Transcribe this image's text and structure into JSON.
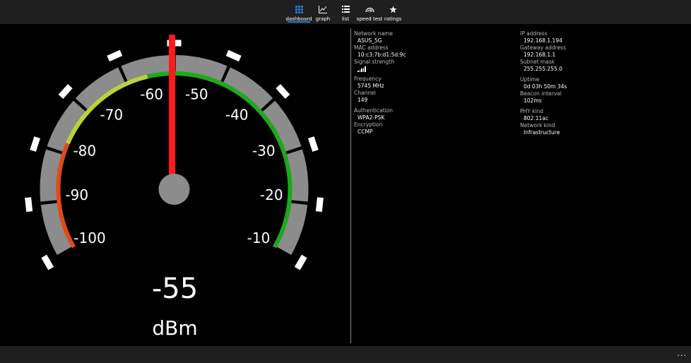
{
  "nav": {
    "items": [
      {
        "label": "dashboard",
        "icon": "grid-icon",
        "active": true
      },
      {
        "label": "graph",
        "icon": "chart-line-icon",
        "active": false
      },
      {
        "label": "list",
        "icon": "list-icon",
        "active": false
      },
      {
        "label": "speed test",
        "icon": "speedometer-icon",
        "active": false
      },
      {
        "label": "ratings",
        "icon": "star-icon",
        "active": false
      }
    ],
    "accent": "#1e7bd4"
  },
  "gauge": {
    "value": "-55",
    "numeric_value": -55,
    "unit": "dBm",
    "scale_min": -100,
    "scale_max": -10,
    "tick_labels": [
      "-100",
      "-90",
      "-80",
      "-70",
      "-60",
      "-50",
      "-40",
      "-30",
      "-20",
      "-10"
    ],
    "colors": {
      "bad": "#e04a1a",
      "fair": "#b9d33a",
      "good": "#1ea81e",
      "needle": "#ff1a1a",
      "ring": "#8c8c8c"
    }
  },
  "info_left": {
    "network_name_label": "Network name",
    "network_name": "ASUS_5G",
    "mac_label": "MAC address",
    "mac": "10:c3:7b:d1:5d:9c",
    "signal_label": "Signal strength",
    "signal_icon": "signal-bars-icon",
    "frequency_label": "Frequency",
    "frequency": "5745 MHz",
    "channel_label": "Channel",
    "channel": "149",
    "auth_label": "Authentication",
    "auth": "WPA2-PSK",
    "encryption_label": "Encryption",
    "encryption": "CCMP"
  },
  "info_right": {
    "ip_label": "IP address",
    "ip": "192.168.1.194",
    "gateway_label": "Gateway address",
    "gateway": "192.168.1.1",
    "subnet_label": "Subnet mask",
    "subnet": "255.255.255.0",
    "uptime_label": "Uptime",
    "uptime": "0d 03h 50m 34s",
    "beacon_label": "Beacon interval",
    "beacon": "102ms",
    "phy_label": "PHY kind",
    "phy": "802.11ac",
    "network_kind_label": "Network kind",
    "network_kind": "Infrastructure"
  },
  "bottom": {
    "more_label": "..."
  }
}
